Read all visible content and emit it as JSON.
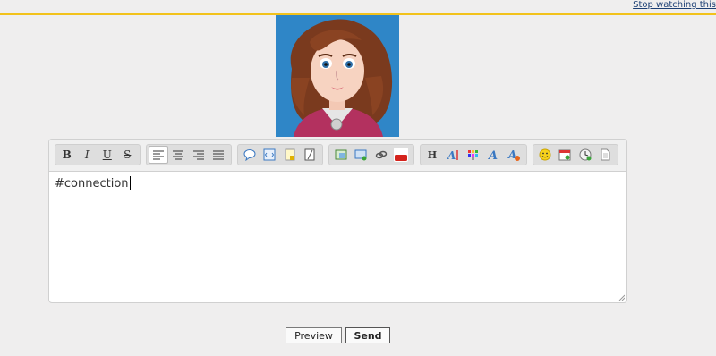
{
  "header": {
    "stop_watching_label": "Stop watching this"
  },
  "editor": {
    "content": "#connection",
    "toolbar": {
      "text_format": [
        {
          "name": "bold",
          "glyph": "B"
        },
        {
          "name": "italic",
          "glyph": "I"
        },
        {
          "name": "underline",
          "glyph": "U"
        },
        {
          "name": "strikethrough",
          "glyph": "S"
        }
      ],
      "alignment": [
        "align-left",
        "align-center",
        "align-right",
        "align-justify"
      ],
      "insert": [
        "quote-icon",
        "code-icon",
        "spoiler-icon",
        "hide-icon"
      ],
      "media": [
        "image-icon",
        "host-image-icon",
        "link-icon",
        "youtube-icon"
      ],
      "youtube_text": "You Tube",
      "heading_glyph": "H",
      "style": [
        "heading-icon",
        "font-size-icon",
        "color-icon",
        "font-face-icon",
        "remove-format-icon"
      ],
      "misc": [
        "smiley-icon",
        "date-icon",
        "time-icon",
        "page-icon"
      ]
    }
  },
  "buttons": {
    "preview_label": "Preview",
    "send_label": "Send"
  },
  "colors": {
    "accent_line": "#f2c21b",
    "avatar_bg": "#2f86c7"
  }
}
